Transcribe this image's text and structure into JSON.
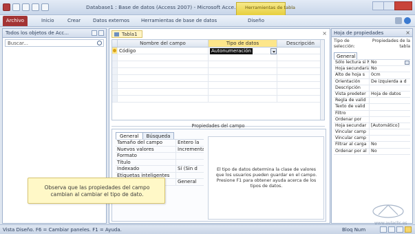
{
  "window": {
    "title": "Database1 : Base de datos (Access 2007) - Microsoft Acce...",
    "context_tab": "Herramientas de tabla"
  },
  "ribbon": {
    "tabs": [
      "Archivo",
      "Inicio",
      "Crear",
      "Datos externos",
      "Herramientas de base de datos",
      "Diseño"
    ]
  },
  "nav_pane": {
    "header": "Todos los objetos de Acc...",
    "search_placeholder": "Buscar..."
  },
  "document": {
    "tab_label": "Tabla1",
    "columns": [
      "Nombre del campo",
      "Tipo de datos",
      "Descripción"
    ],
    "rows": [
      {
        "field": "Código",
        "type": "Autonumeración",
        "description": ""
      }
    ],
    "field_properties_label": "Propiedades del campo",
    "prop_tabs": [
      "General",
      "Búsqueda"
    ],
    "properties": [
      {
        "key": "Tamaño del campo",
        "value": "Entero la"
      },
      {
        "key": "Nuevos valores",
        "value": "Incrementa"
      },
      {
        "key": "Formato",
        "value": ""
      },
      {
        "key": "Título",
        "value": ""
      },
      {
        "key": "Indexado",
        "value": "Sí (Sin d"
      },
      {
        "key": "Etiquetas inteligentes",
        "value": ""
      },
      {
        "key": "Alineación del texto",
        "value": "General"
      }
    ],
    "help_text": "El tipo de datos determina la clase de valores que los usuarios pueden guardar en el campo. Presione F1 para obtener ayuda acerca de los tipos de datos."
  },
  "callout": {
    "text": "Observa que las propiedades del campo cambian al cambiar el tipo de dato."
  },
  "property_sheet": {
    "header": "Hoja de propiedades",
    "selection_type_label": "Tipo de selección:",
    "selection_value": "Propiedades de la tabla",
    "tab": "General",
    "rows": [
      {
        "key": "Sólo lectura si Ne",
        "value": "No"
      },
      {
        "key": "Hoja secundaria",
        "value": "No"
      },
      {
        "key": "Alto de hoja s",
        "value": "0cm"
      },
      {
        "key": "Orientación",
        "value": "De izquierda a d"
      },
      {
        "key": "Descripción",
        "value": ""
      },
      {
        "key": "Vista predeter",
        "value": "Hoja de datos"
      },
      {
        "key": "Regla de valid",
        "value": ""
      },
      {
        "key": "Texto de valid",
        "value": ""
      },
      {
        "key": "Filtro",
        "value": ""
      },
      {
        "key": "Ordenar por",
        "value": ""
      },
      {
        "key": "Hoja secundar",
        "value": "[Automático]"
      },
      {
        "key": "Vincular camp",
        "value": ""
      },
      {
        "key": "Vincular camp",
        "value": ""
      },
      {
        "key": "Filtrar al carga",
        "value": "No"
      },
      {
        "key": "Ordenar por al",
        "value": "No"
      }
    ],
    "watermark": "www.aulaclic.es"
  },
  "status": {
    "left": "Vista Diseño. F6 = Cambiar paneles. F1 = Ayuda.",
    "right": "Bloq Num"
  }
}
